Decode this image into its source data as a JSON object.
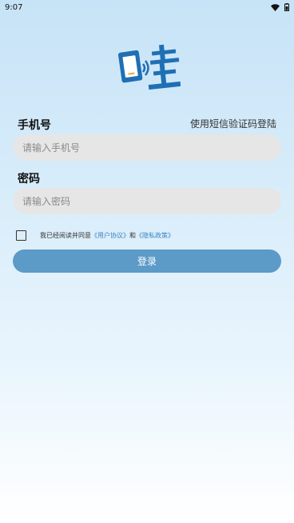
{
  "status": {
    "time": "9:07",
    "wifi_icon": "wifi-icon",
    "battery_icon": "battery-icon"
  },
  "logo": {
    "icon": "app-logo-wa",
    "text": "哇"
  },
  "form": {
    "phone_label": "手机号",
    "sms_login_label": "使用短信验证码登陆",
    "phone_placeholder": "请输入手机号",
    "phone_value": "",
    "password_label": "密码",
    "password_placeholder": "请输入密码",
    "password_value": ""
  },
  "agreement": {
    "checked": false,
    "prefix": "我已经阅读并同意",
    "user_agreement": "《用户协议》",
    "conjunction": "和",
    "privacy_policy": "《隐私政策》"
  },
  "login": {
    "button_label": "登录"
  },
  "colors": {
    "accent": "#5c9ac8",
    "link": "#3a84c0",
    "logo_blue": "#1f6fb4",
    "input_bg": "#e6e6e6"
  }
}
